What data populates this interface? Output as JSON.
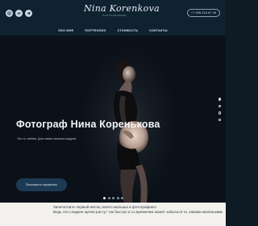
{
  "header": {
    "logo_script": "Nina Korenkova",
    "logo_subtitle": "PHOTOGRAPHER",
    "phone": "+7 905 218 87 49",
    "socials": [
      {
        "icon": "instagram-icon"
      },
      {
        "icon": "vk-icon"
      },
      {
        "icon": "telegram-icon"
      }
    ],
    "nav": [
      "ОБО МНЕ",
      "ПОРТФОЛИО",
      "СТОИМОСТЬ",
      "КОНТАКТЫ"
    ]
  },
  "hero": {
    "title": "Фотограф Нина Коренькова",
    "subtitle": "Это то любви. Для самых важных кадров.",
    "cta": "Посмотреть портфолио",
    "slide_dots_vertical": 4,
    "slide_dots_horizontal": 5,
    "active_slide": 1
  },
  "intro": {
    "line1": "Запечатлите первый месяц своего малыша в фотографиях!",
    "line2": "Ведь эти сладкие щечки растут так быстро и со временем может забыться то, какими маленькими дети"
  },
  "colors": {
    "header_bg": "#0f2230",
    "hero_bg": "#0b1118",
    "cta_bg": "#1d3a55",
    "intro_bg": "#f2f1ee"
  }
}
